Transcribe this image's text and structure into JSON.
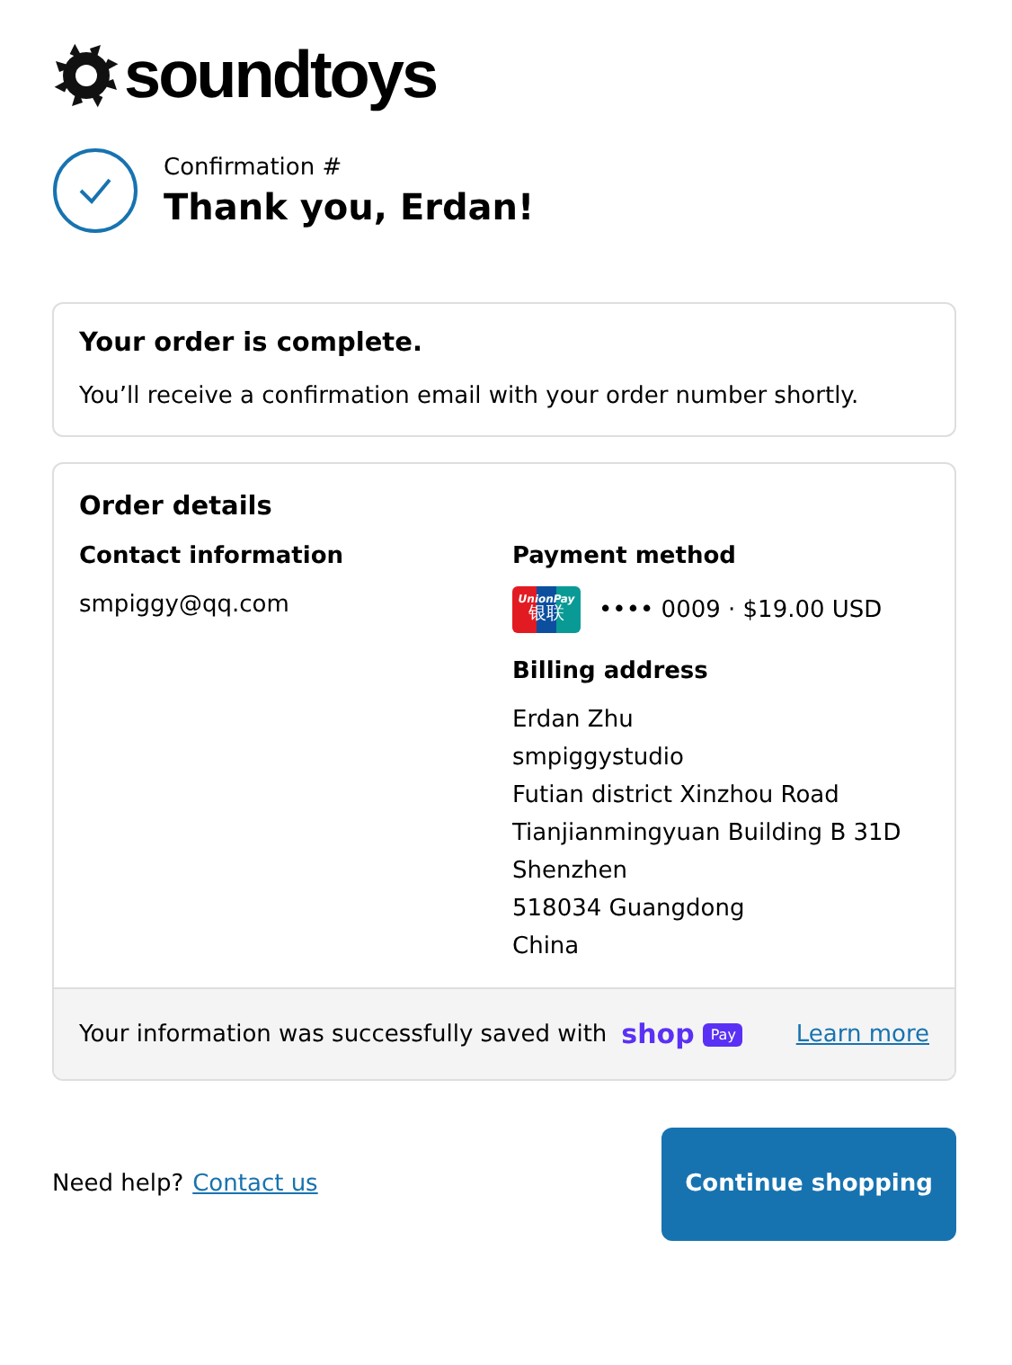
{
  "brand": {
    "name": "soundtoys"
  },
  "header": {
    "confirmation": "Confirmation #",
    "title": "Thank you, Erdan!"
  },
  "status_card": {
    "title": "Your order is complete.",
    "message": "You’ll receive a confirmation email with your order number shortly."
  },
  "order_details": {
    "title": "Order details",
    "contact": {
      "heading": "Contact information",
      "email": "smpiggy@qq.com"
    },
    "payment": {
      "heading": "Payment method",
      "card_brand": "UnionPay",
      "card_brand_local": "银联",
      "summary": "•••• 0009 · $19.00 USD"
    },
    "billing": {
      "heading": "Billing address",
      "lines": [
        "Erdan Zhu",
        "smpiggystudio",
        "Futian district Xinzhou Road",
        "Tianjianmingyuan Building B 31D",
        "Shenzhen",
        "518034 Guangdong",
        "China"
      ]
    },
    "footer": {
      "message": "Your information was successfully saved with",
      "shop": "shop",
      "pay": "Pay",
      "link": "Learn more"
    }
  },
  "footer": {
    "help": "Need help?",
    "contact_link": "Contact us",
    "button": "Continue shopping"
  }
}
